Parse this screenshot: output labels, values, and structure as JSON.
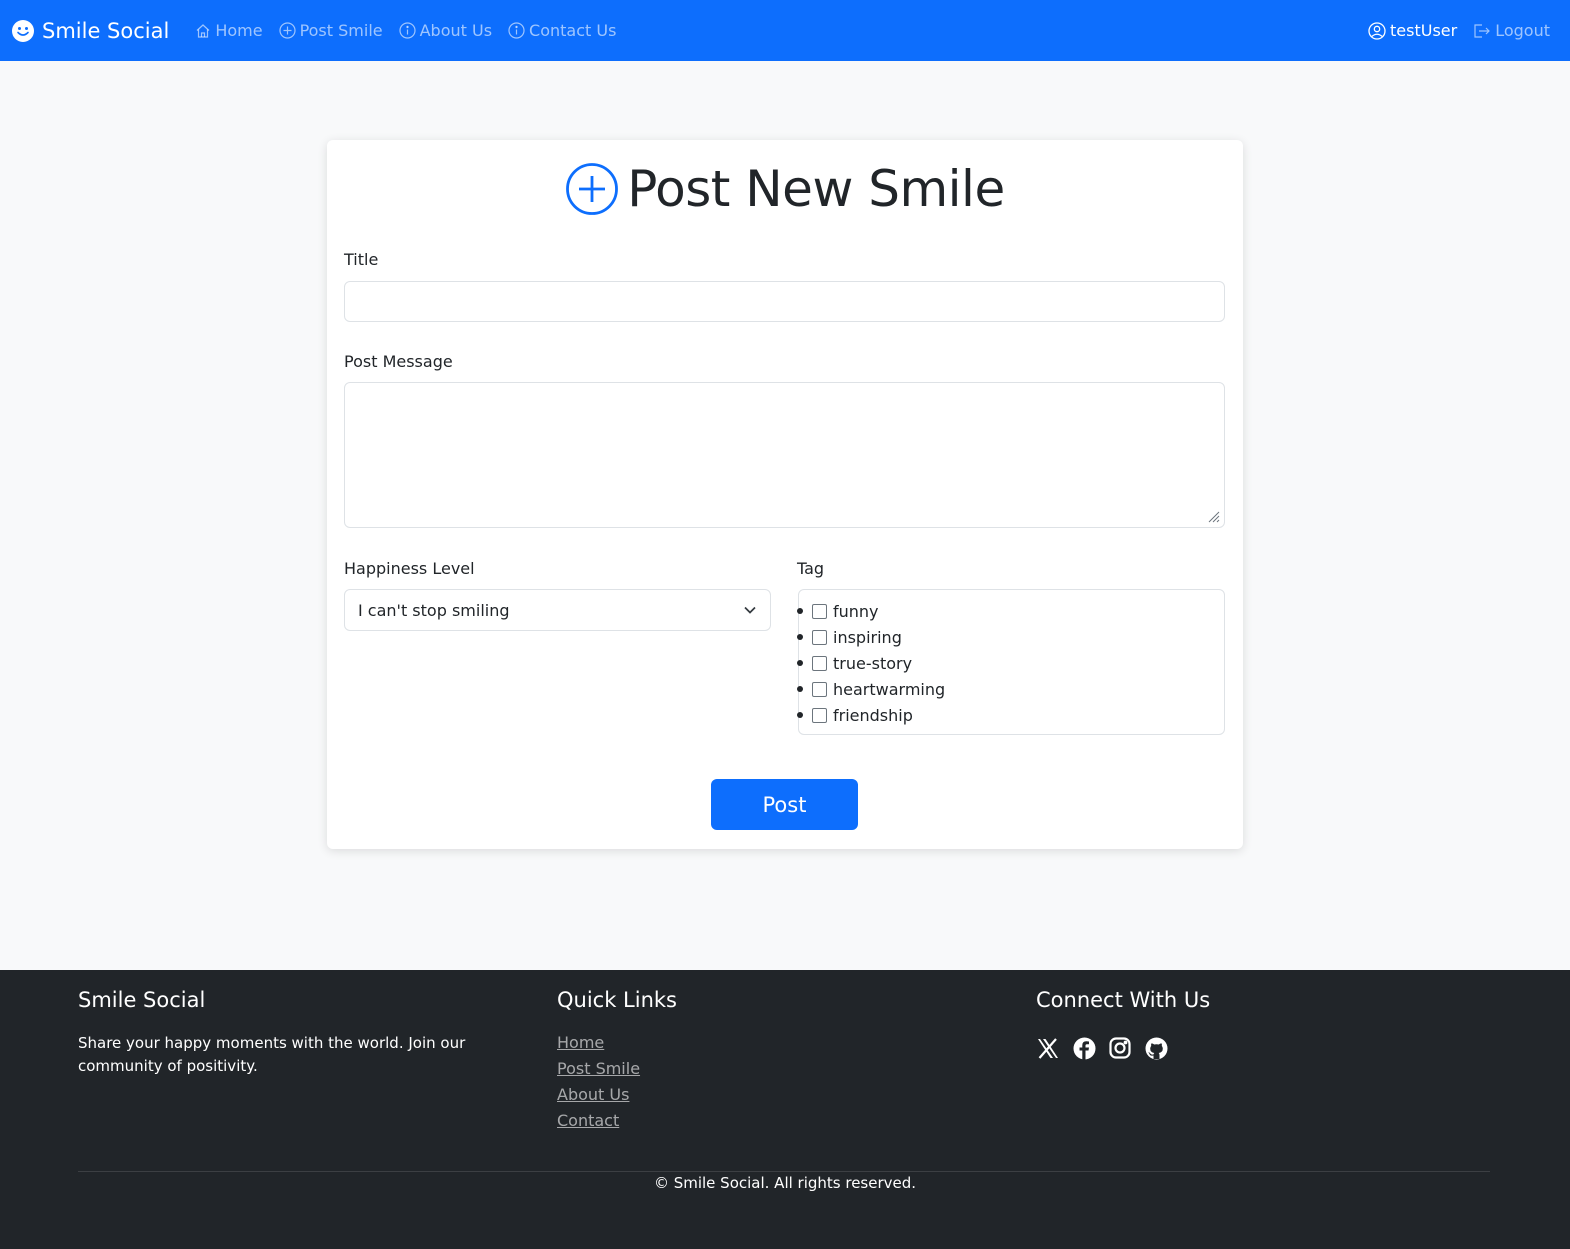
{
  "navbar": {
    "brand": "Smile Social",
    "links": [
      {
        "label": "Home",
        "icon": "house-icon"
      },
      {
        "label": "Post Smile",
        "icon": "plus-circle-icon"
      },
      {
        "label": "About Us",
        "icon": "info-circle-icon"
      },
      {
        "label": "Contact Us",
        "icon": "info-circle-icon"
      }
    ],
    "user": "testUser",
    "logout": "Logout"
  },
  "form": {
    "heading": "Post New Smile",
    "title_label": "Title",
    "title_value": "",
    "message_label": "Post Message",
    "message_value": "",
    "happiness_label": "Happiness Level",
    "happiness_value": "I can't stop smiling",
    "tag_label": "Tag",
    "tags": [
      "funny",
      "inspiring",
      "true-story",
      "heartwarming",
      "friendship"
    ],
    "submit": "Post"
  },
  "footer": {
    "brand": "Smile Social",
    "description": "Share your happy moments with the world. Join our community of positivity.",
    "quick_links_title": "Quick Links",
    "quick_links": [
      "Home",
      "Post Smile",
      "About Us",
      "Contact"
    ],
    "connect_title": "Connect With Us",
    "social_icons": [
      "x-twitter-icon",
      "facebook-icon",
      "instagram-icon",
      "github-icon"
    ],
    "copyright": "© Smile Social. All rights reserved."
  },
  "colors": {
    "primary": "#0d6efd",
    "footer_bg": "#212529",
    "page_bg": "#f8f9fa"
  }
}
